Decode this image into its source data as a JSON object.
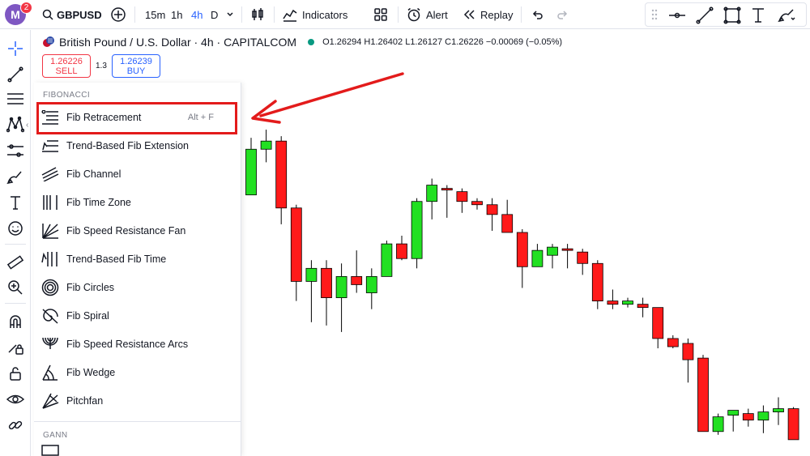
{
  "account": {
    "avatar_letter": "M",
    "notification_count": "2"
  },
  "toolbar": {
    "symbol": "GBPUSD",
    "timeframes": [
      "15m",
      "1h",
      "4h",
      "D"
    ],
    "active_timeframe": "4h",
    "indicators_label": "Indicators",
    "alert_label": "Alert",
    "replay_label": "Replay"
  },
  "legend": {
    "title": "British Pound / U.S. Dollar · 4h · CAPITALCOM",
    "ohlc": "O1.26294  H1.26402  L1.26127  C1.26226  −0.00069 (−0.05%)"
  },
  "trade": {
    "sell_price": "1.26226",
    "sell_label": "SELL",
    "spread": "1.3",
    "buy_price": "1.26239",
    "buy_label": "BUY"
  },
  "menu": {
    "section_fibonacci": "FIBONACCI",
    "section_gann": "GANN",
    "items": [
      {
        "label": "Fib Retracement",
        "hotkey": "Alt + F",
        "icon": "fib-retracement-icon"
      },
      {
        "label": "Trend-Based Fib Extension",
        "hotkey": "",
        "icon": "fib-extension-icon"
      },
      {
        "label": "Fib Channel",
        "hotkey": "",
        "icon": "fib-channel-icon"
      },
      {
        "label": "Fib Time Zone",
        "hotkey": "",
        "icon": "fib-time-zone-icon"
      },
      {
        "label": "Fib Speed Resistance Fan",
        "hotkey": "",
        "icon": "fib-fan-icon"
      },
      {
        "label": "Trend-Based Fib Time",
        "hotkey": "",
        "icon": "fib-time-icon"
      },
      {
        "label": "Fib Circles",
        "hotkey": "",
        "icon": "fib-circles-icon"
      },
      {
        "label": "Fib Spiral",
        "hotkey": "",
        "icon": "fib-spiral-icon"
      },
      {
        "label": "Fib Speed Resistance Arcs",
        "hotkey": "",
        "icon": "fib-arcs-icon"
      },
      {
        "label": "Fib Wedge",
        "hotkey": "",
        "icon": "fib-wedge-icon"
      },
      {
        "label": "Pitchfan",
        "hotkey": "",
        "icon": "pitchfan-icon"
      }
    ]
  },
  "colors": {
    "up": "#22e022",
    "down": "#ff1a1a",
    "accent": "#2962ff",
    "highlight": "#e31b1b"
  },
  "candles": [
    {
      "o": 1.26,
      "h": 1.2635,
      "l": 1.26,
      "c": 1.2628
    },
    {
      "o": 1.2628,
      "h": 1.264,
      "l": 1.262,
      "c": 1.2633
    },
    {
      "o": 1.2633,
      "h": 1.2636,
      "l": 1.2582,
      "c": 1.2592
    },
    {
      "o": 1.2592,
      "h": 1.2594,
      "l": 1.2535,
      "c": 1.2547
    },
    {
      "o": 1.2547,
      "h": 1.256,
      "l": 1.2522,
      "c": 1.2555
    },
    {
      "o": 1.2555,
      "h": 1.256,
      "l": 1.252,
      "c": 1.2537
    },
    {
      "o": 1.2537,
      "h": 1.2558,
      "l": 1.2516,
      "c": 1.255
    },
    {
      "o": 1.255,
      "h": 1.2566,
      "l": 1.254,
      "c": 1.2545
    },
    {
      "o": 1.254,
      "h": 1.2555,
      "l": 1.253,
      "c": 1.255
    },
    {
      "o": 1.255,
      "h": 1.2572,
      "l": 1.255,
      "c": 1.257
    },
    {
      "o": 1.257,
      "h": 1.2575,
      "l": 1.256,
      "c": 1.2561
    },
    {
      "o": 1.2561,
      "h": 1.2598,
      "l": 1.2555,
      "c": 1.2596
    },
    {
      "o": 1.2596,
      "h": 1.261,
      "l": 1.2585,
      "c": 1.2606
    },
    {
      "o": 1.2604,
      "h": 1.2606,
      "l": 1.2586,
      "c": 1.2603
    },
    {
      "o": 1.2602,
      "h": 1.2604,
      "l": 1.2589,
      "c": 1.2596
    },
    {
      "o": 1.2596,
      "h": 1.2598,
      "l": 1.2591,
      "c": 1.2594
    },
    {
      "o": 1.2594,
      "h": 1.2598,
      "l": 1.2578,
      "c": 1.2588
    },
    {
      "o": 1.2588,
      "h": 1.2597,
      "l": 1.2577,
      "c": 1.2577
    },
    {
      "o": 1.2577,
      "h": 1.2579,
      "l": 1.2543,
      "c": 1.2556
    },
    {
      "o": 1.2556,
      "h": 1.257,
      "l": 1.2556,
      "c": 1.2566
    },
    {
      "o": 1.2563,
      "h": 1.257,
      "l": 1.2555,
      "c": 1.2568
    },
    {
      "o": 1.2567,
      "h": 1.257,
      "l": 1.2555,
      "c": 1.2566
    },
    {
      "o": 1.2565,
      "h": 1.2567,
      "l": 1.2551,
      "c": 1.2558
    },
    {
      "o": 1.2558,
      "h": 1.256,
      "l": 1.253,
      "c": 1.2535
    },
    {
      "o": 1.2535,
      "h": 1.2542,
      "l": 1.253,
      "c": 1.2533
    },
    {
      "o": 1.2533,
      "h": 1.2537,
      "l": 1.2531,
      "c": 1.2535
    },
    {
      "o": 1.2533,
      "h": 1.2537,
      "l": 1.2525,
      "c": 1.2531
    },
    {
      "o": 1.2531,
      "h": 1.2531,
      "l": 1.2506,
      "c": 1.2512
    },
    {
      "o": 1.2512,
      "h": 1.2514,
      "l": 1.2506,
      "c": 1.2507
    },
    {
      "o": 1.2509,
      "h": 1.2512,
      "l": 1.2485,
      "c": 1.2499
    },
    {
      "o": 1.25,
      "h": 1.2502,
      "l": 1.2455,
      "c": 1.2455
    },
    {
      "o": 1.2455,
      "h": 1.2466,
      "l": 1.2453,
      "c": 1.2464
    },
    {
      "o": 1.2465,
      "h": 1.2468,
      "l": 1.2455,
      "c": 1.2468
    },
    {
      "o": 1.2466,
      "h": 1.2469,
      "l": 1.2458,
      "c": 1.2462
    },
    {
      "o": 1.2462,
      "h": 1.2471,
      "l": 1.2454,
      "c": 1.2467
    },
    {
      "o": 1.2467,
      "h": 1.2476,
      "l": 1.2459,
      "c": 1.2469
    },
    {
      "o": 1.2469,
      "h": 1.247,
      "l": 1.245,
      "c": 1.245
    }
  ]
}
